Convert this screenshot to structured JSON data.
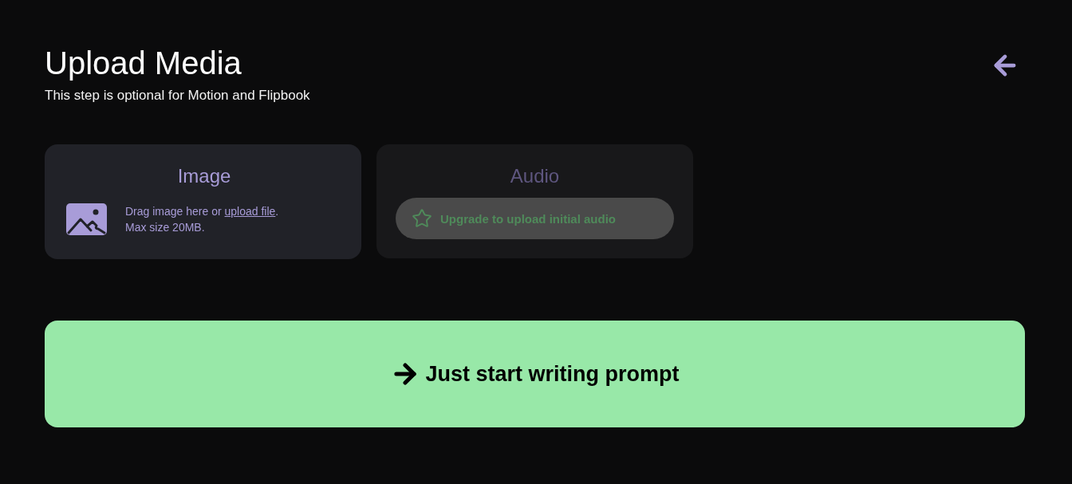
{
  "header": {
    "title": "Upload Media",
    "subtitle": "This step is optional for Motion and Flipbook"
  },
  "media_cards": [
    {
      "kind": "upload",
      "title": "Image",
      "disabled": false,
      "instruction": "Drag image here or ",
      "link": "upload file",
      "instruction_end": ".",
      "note": "Max size 20MB."
    },
    {
      "kind": "upgrade",
      "title": "Audio",
      "disabled": true,
      "upgrade_label": "Upgrade to upload initial audio"
    }
  ],
  "primary_button": {
    "label": "Just start writing prompt"
  }
}
